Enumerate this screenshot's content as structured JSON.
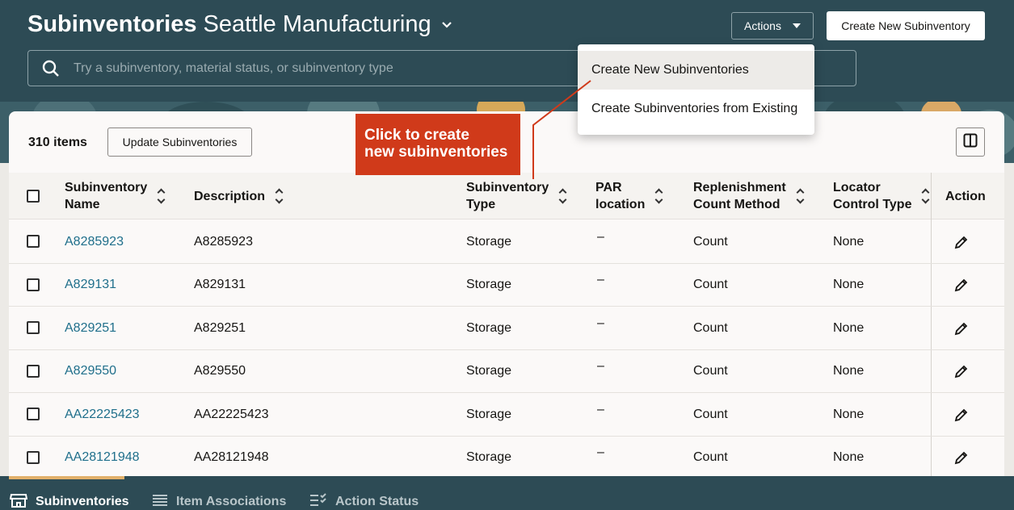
{
  "header": {
    "title_strong": "Subinventories",
    "title_rest": "Seattle Manufacturing",
    "actions_label": "Actions",
    "create_label": "Create New Subinventory",
    "search_placeholder": "Try a subinventory, material status, or subinventory type"
  },
  "actions_menu": {
    "items": [
      "Create New Subinventories",
      "Create Subinventories from Existing"
    ]
  },
  "callout": {
    "line1": "Click to create",
    "line2": "new subinventories"
  },
  "toolbar": {
    "items_count": "310 items",
    "update_label": "Update Subinventories"
  },
  "table": {
    "headers": {
      "name_1": "Subinventory",
      "name_2": "Name",
      "description": "Description",
      "type_1": "Subinventory",
      "type_2": "Type",
      "par_1": "PAR",
      "par_2": "location",
      "repl_1": "Replenishment",
      "repl_2": "Count Method",
      "loc_1": "Locator",
      "loc_2": "Control Type",
      "action": "Action"
    },
    "rows": [
      {
        "name": "A8285923",
        "description": "A8285923",
        "type": "Storage",
        "par": "–",
        "method": "Count",
        "locator": "None"
      },
      {
        "name": "A829131",
        "description": "A829131",
        "type": "Storage",
        "par": "–",
        "method": "Count",
        "locator": "None"
      },
      {
        "name": "A829251",
        "description": "A829251",
        "type": "Storage",
        "par": "–",
        "method": "Count",
        "locator": "None"
      },
      {
        "name": "A829550",
        "description": "A829550",
        "type": "Storage",
        "par": "–",
        "method": "Count",
        "locator": "None"
      },
      {
        "name": "AA22225423",
        "description": "AA22225423",
        "type": "Storage",
        "par": "–",
        "method": "Count",
        "locator": "None"
      },
      {
        "name": "AA28121948",
        "description": "AA28121948",
        "type": "Storage",
        "par": "–",
        "method": "Count",
        "locator": "None"
      }
    ]
  },
  "bottom_tabs": [
    "Subinventories",
    "Item Associations",
    "Action Status"
  ],
  "colors": {
    "header_bg": "#2d4b55",
    "link": "#1f6f8b",
    "callout": "#d03a1a",
    "tab_accent": "#e2b16b"
  },
  "icons": {
    "title_chevron": "chevron-down-icon",
    "search": "search-icon",
    "columns": "columns-icon",
    "edit": "pencil-icon",
    "tab1": "store-icon",
    "tab2": "list-icon",
    "tab3": "checklist-icon"
  }
}
